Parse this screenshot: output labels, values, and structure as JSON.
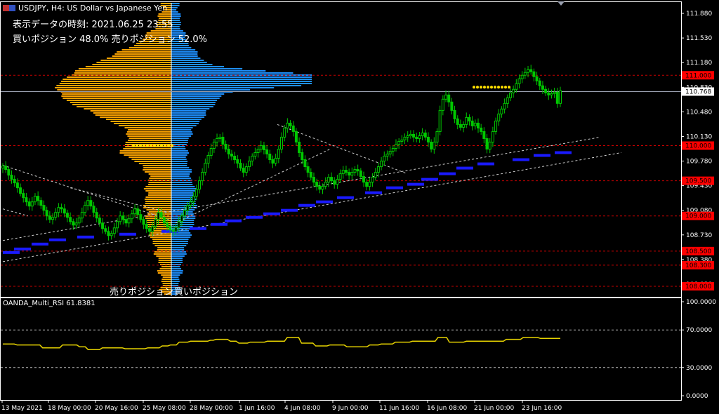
{
  "header": {
    "symbol_line": "USDJPY, H4:  US Dollar vs Japanese Yen",
    "data_time_line": "表示データの時刻: 2021.06.25 23:55",
    "position_line": "買いポジション 48.0% 売りポジション 52.0%"
  },
  "histogram_labels": {
    "sell": "売りポジション",
    "buy": "買いポジション"
  },
  "indicator_label": "OANDA_Multi_RSI 61.8381",
  "colors": {
    "background": "#000000",
    "axis": "#ffffff",
    "candle": "#00c800",
    "sell_histogram": "#ffa500",
    "buy_histogram": "#1e90ff",
    "level_line": "#c80000",
    "level_badge": "#ff0000",
    "trend_line": "#cfcfcf",
    "support_steps": "#1a1aff",
    "rsi_line": "#e6d200",
    "current_price_line": "#9aa0b0"
  },
  "chart_data": [
    {
      "type": "line",
      "subtype": "candlestick",
      "symbol": "USDJPY",
      "timeframe": "H4",
      "ylim": [
        107.85,
        112.05
      ],
      "y_tick_labels": [
        "111.880",
        "111.530",
        "111.180",
        "110.830",
        "110.480",
        "110.130",
        "109.780",
        "109.430",
        "109.080",
        "108.730",
        "108.380",
        "108.030"
      ],
      "x_tick_labels": [
        "13 May 2021",
        "18 May 00:00",
        "20 May 16:00",
        "25 May 08:00",
        "28 May 00:00",
        "1 Jun 16:00",
        "4 Jun 08:00",
        "9 Jun 00:00",
        "11 Jun 16:00",
        "16 Jun 08:00",
        "21 Jun 00:00",
        "23 Jun 16:00"
      ],
      "horizontal_levels": [
        "111.000",
        "110.000",
        "109.500",
        "109.000",
        "108.500",
        "108.300",
        "108.000"
      ],
      "current_price": "110.768",
      "close_series": [
        109.71,
        109.66,
        109.58,
        109.52,
        109.47,
        109.4,
        109.32,
        109.26,
        109.2,
        109.14,
        109.2,
        109.28,
        109.22,
        109.15,
        109.08,
        109.0,
        108.95,
        108.98,
        109.05,
        109.12,
        109.1,
        109.04,
        108.98,
        108.92,
        108.87,
        108.9,
        108.97,
        109.05,
        109.15,
        109.22,
        109.14,
        109.05,
        108.97,
        108.9,
        108.82,
        108.78,
        108.72,
        108.75,
        108.83,
        108.92,
        109.0,
        108.95,
        108.9,
        108.96,
        109.03,
        109.1,
        109.02,
        108.95,
        108.88,
        108.82,
        108.78,
        108.85,
        108.95,
        109.05,
        108.98,
        108.9,
        108.85,
        108.8,
        108.78,
        108.84,
        108.92,
        109.0,
        109.08,
        109.15,
        109.2,
        109.28,
        109.38,
        109.5,
        109.62,
        109.75,
        109.86,
        109.96,
        110.05,
        110.1,
        110.12,
        110.02,
        109.95,
        109.88,
        109.85,
        109.8,
        109.75,
        109.68,
        109.62,
        109.7,
        109.78,
        109.85,
        109.9,
        109.95,
        110.0,
        109.94,
        109.88,
        109.8,
        109.75,
        109.82,
        109.95,
        110.12,
        110.25,
        110.32,
        110.28,
        110.2,
        110.05,
        109.9,
        109.8,
        109.7,
        109.62,
        109.55,
        109.48,
        109.42,
        109.38,
        109.42,
        109.48,
        109.55,
        109.5,
        109.45,
        109.52,
        109.6,
        109.65,
        109.62,
        109.58,
        109.62,
        109.66,
        109.64,
        109.56,
        109.48,
        109.42,
        109.48,
        109.55,
        109.62,
        109.7,
        109.78,
        109.85,
        109.88,
        109.92,
        109.96,
        110.02,
        110.06,
        110.08,
        110.12,
        110.14,
        110.16,
        110.12,
        110.1,
        110.14,
        110.18,
        110.12,
        110.05,
        109.95,
        110.05,
        110.2,
        110.5,
        110.66,
        110.72,
        110.62,
        110.5,
        110.38,
        110.3,
        110.26,
        110.3,
        110.4,
        110.35,
        110.28,
        110.32,
        110.25,
        110.2,
        110.1,
        109.95,
        110.05,
        110.2,
        110.35,
        110.45,
        110.52,
        110.6,
        110.68,
        110.75,
        110.8,
        110.88,
        110.95,
        111.0,
        111.04,
        111.08,
        111.05,
        110.98,
        110.92,
        110.85,
        110.8,
        110.75,
        110.72,
        110.74,
        110.76,
        110.6,
        110.78
      ]
    },
    {
      "type": "line",
      "name": "OANDA_Multi_RSI",
      "ylim": [
        0,
        100
      ],
      "y_tick_labels": [
        "100.0000",
        "70.0000",
        "30.0000",
        "0.0000"
      ],
      "y_ticks": [
        100,
        70,
        30,
        0
      ],
      "reference_levels": [
        70,
        30
      ],
      "values": [
        55,
        55,
        55,
        55,
        55,
        54,
        54,
        54,
        54,
        54,
        54,
        54,
        54,
        54,
        51,
        51,
        51,
        51,
        51,
        51,
        51,
        54,
        54,
        54,
        54,
        54,
        54,
        52,
        52,
        52,
        49,
        49,
        49,
        49,
        49,
        51,
        51,
        51,
        51,
        51,
        51,
        51,
        51,
        50,
        50,
        50,
        50,
        50,
        50,
        50,
        50,
        51,
        51,
        51,
        51,
        51,
        53,
        53,
        53,
        54,
        54,
        54,
        57,
        57,
        57,
        57,
        58,
        58,
        58,
        58,
        58,
        58,
        58,
        59,
        59,
        60,
        60,
        60,
        60,
        60,
        58,
        58,
        58,
        56,
        56,
        56,
        56,
        57,
        57,
        57,
        57,
        57,
        57,
        58,
        58,
        58,
        58,
        58,
        58,
        58,
        62,
        62,
        62,
        62,
        62,
        56,
        56,
        56,
        56,
        56,
        53,
        53,
        53,
        53,
        53,
        54,
        54,
        54,
        54,
        54,
        54,
        52,
        52,
        52,
        52,
        52,
        52,
        52,
        52,
        54,
        54,
        54,
        54,
        55,
        55,
        55,
        55,
        55,
        57,
        57,
        57,
        57,
        57,
        57,
        58,
        58,
        58,
        58,
        58,
        58,
        58,
        58,
        58,
        62,
        62,
        62,
        62,
        57,
        57,
        57,
        57,
        57,
        57,
        58,
        58,
        58,
        58,
        58,
        58,
        58,
        58,
        58,
        58,
        58,
        58,
        58,
        58,
        60,
        60,
        60,
        60,
        60,
        60,
        62,
        62,
        62,
        62,
        62,
        62,
        61,
        61,
        61,
        61,
        61,
        61,
        61,
        61
      ]
    },
    {
      "type": "bar",
      "name": "position_histogram",
      "sell_label": "売りポジション",
      "buy_label": "買いポジション",
      "sell_percent": 52.0,
      "buy_percent": 48.0
    }
  ]
}
